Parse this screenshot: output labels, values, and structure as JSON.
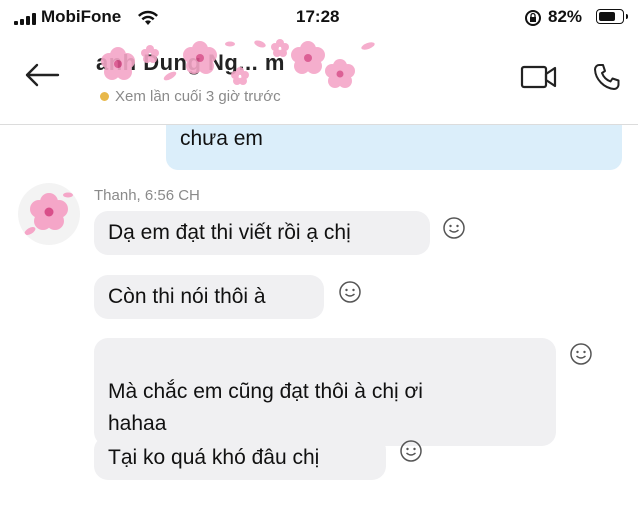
{
  "status_bar": {
    "carrier": "MobiFone",
    "time": "17:28",
    "battery_percent": "82%",
    "battery_level": 0.82
  },
  "header": {
    "contact_name": "anh Dung Ng... m",
    "last_seen": "Xem lần cuối 3 giờ trước",
    "status_color": "#e8b84a"
  },
  "messages": {
    "outgoing_preview": "chưa em",
    "sender_meta": "Thanh, 6:56 CH",
    "incoming": [
      "Dạ em đạt thi viết rồi ạ chị",
      "Còn thi nói thôi à",
      "Mà chắc em cũng đạt thôi à chị ơi\nhahaa",
      "Tại ko quá khó đâu chị"
    ]
  },
  "icons": [
    "back-arrow-icon",
    "video-call-icon",
    "phone-call-icon",
    "smiley-react-icon",
    "wifi-icon",
    "rotation-lock-icon"
  ],
  "colors": {
    "outgoing_bubble": "#dbeefa",
    "incoming_bubble": "#f0f0f2",
    "accent_pink": "#f28cb8"
  }
}
